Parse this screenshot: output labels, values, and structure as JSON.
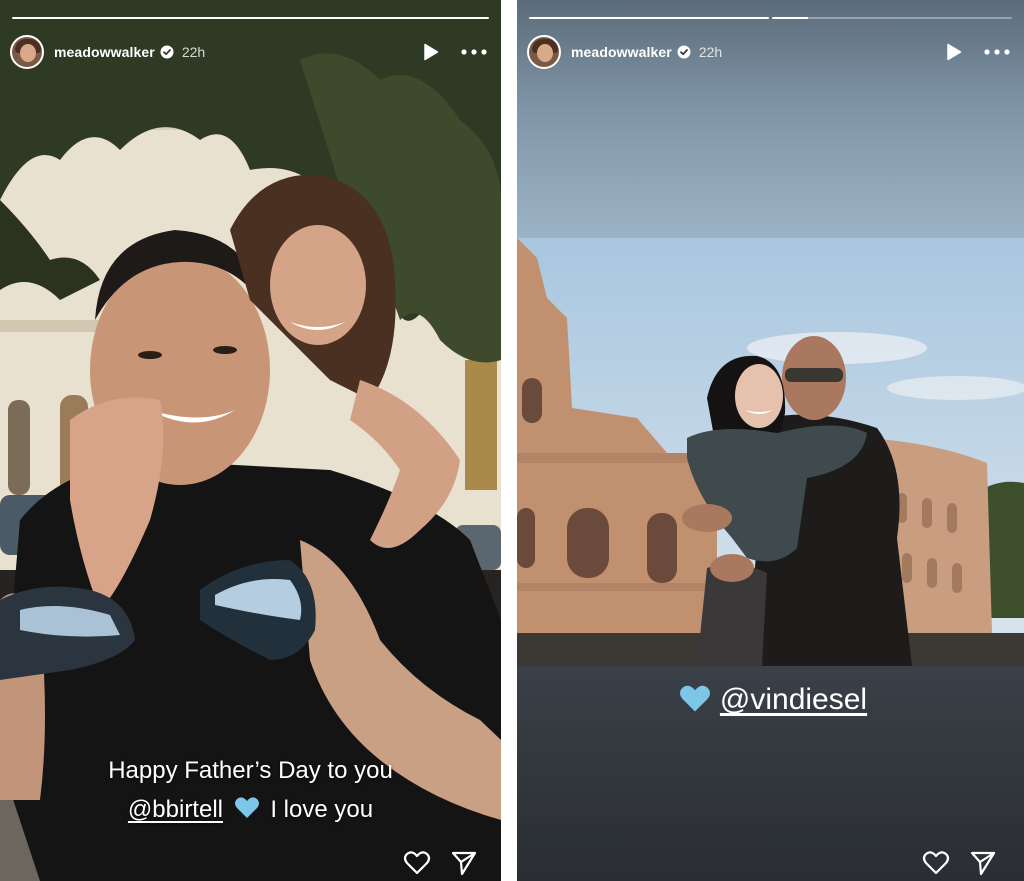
{
  "left_story": {
    "username": "meadowwalker",
    "time": "22h",
    "progress": [
      1.0
    ],
    "caption_line1": "Happy Father’s Day to you",
    "caption_mention": "@bbirtell",
    "caption_suffix": "I love you"
  },
  "right_story": {
    "username": "meadowwalker",
    "time": "22h",
    "progress": [
      1.0,
      0.15
    ],
    "mention": "@vindiesel"
  },
  "icons": {
    "verified": "verified-badge-icon",
    "play": "play-icon",
    "more": "more-options-icon",
    "heart_emoji": "light-blue-heart-icon",
    "like": "heart-outline-icon",
    "share": "send-icon"
  },
  "colors": {
    "heart_emoji": "#7cc6e8",
    "text": "#ffffff"
  }
}
